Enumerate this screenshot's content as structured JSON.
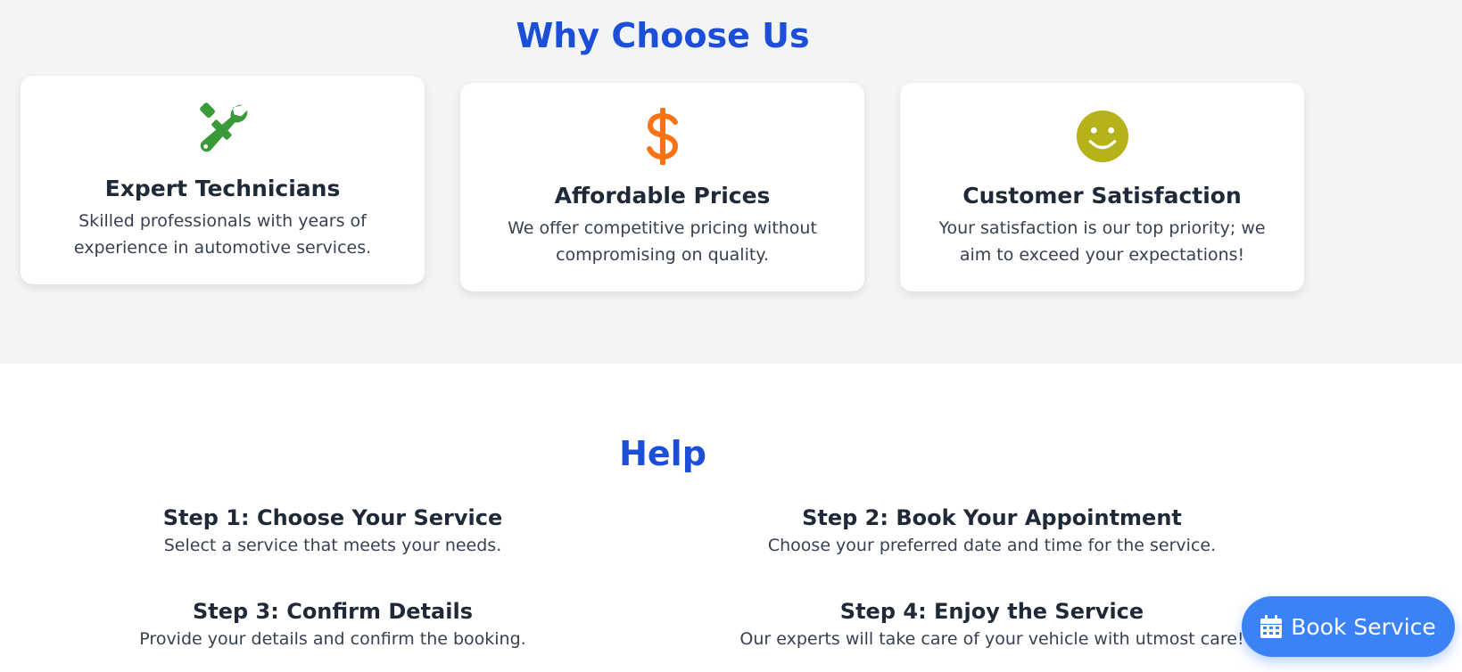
{
  "why_section": {
    "title": "Why Choose Us",
    "cards": [
      {
        "icon": "tools-icon",
        "icon_color": "#3a9a3a",
        "title": "Expert Technicians",
        "description": "Skilled professionals with years of experience in automotive services."
      },
      {
        "icon": "dollar-icon",
        "icon_color": "#f97316",
        "title": "Affordable Prices",
        "description": "We offer competitive pricing without compromising on quality."
      },
      {
        "icon": "smile-icon",
        "icon_color": "#b5b21a",
        "title": "Customer Satisfaction",
        "description": "Your satisfaction is our top priority; we aim to exceed your expectations!"
      }
    ]
  },
  "help_section": {
    "title": "Help",
    "steps": [
      {
        "title": "Step 1: Choose Your Service",
        "description": "Select a service that meets your needs."
      },
      {
        "title": "Step 2: Book Your Appointment",
        "description": "Choose your preferred date and time for the service."
      },
      {
        "title": "Step 3: Confirm Details",
        "description": "Provide your details and confirm the booking."
      },
      {
        "title": "Step 4: Enjoy the Service",
        "description": "Our experts will take care of your vehicle with utmost care!"
      }
    ]
  },
  "book_button": {
    "label": "Book Service",
    "icon": "calendar-icon",
    "color": "#3b82f6"
  },
  "colors": {
    "heading": "#1d4ed8",
    "section_bg": "#f3f4f6",
    "card_bg": "#ffffff",
    "text": "#1f2937"
  }
}
